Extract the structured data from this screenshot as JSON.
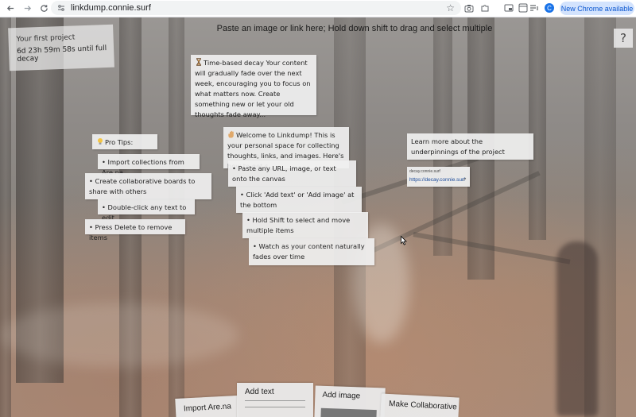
{
  "browser": {
    "url": "linkdump.connie.surf",
    "avatar_letter": "C",
    "update_label": "New Chrome available",
    "icons": [
      "back-icon",
      "forward-icon",
      "reload-icon",
      "tune-icon",
      "star-icon",
      "camera-icon",
      "extensions-icon",
      "cast-icon",
      "tab-search-icon",
      "media-icon",
      "menu-icon"
    ]
  },
  "canvas": {
    "instruction": "Paste an image or link here; Hold down shift to drag and select multiple",
    "help_label": "?"
  },
  "project": {
    "name": "Your first project",
    "timer": "6d 23h 59m 58s until full decay"
  },
  "notes": {
    "decay_text": "Time-based decay Your content will gradually fade over the next week, encouraging you to focus on what matters now. Create something new or let your old thoughts fade away...",
    "welcome_text": "Welcome to Linkdump! This is your personal space for collecting thoughts, links, and images. Here's how to get s",
    "pro_tips": "Pro Tips:",
    "import_arena": "• Import collections from Are.na",
    "collab_boards": "• Create collaborative boards to share with others",
    "double_click": "• Double-click any text to edit",
    "press_delete": "• Press Delete to remove items",
    "paste_url": "• Paste any URL, image, or text onto the canvas",
    "add_text_tip": "• Click 'Add text' or 'Add image' at the bottom",
    "shift_tip": "• Hold Shift to select and move multiple items",
    "fade_tip": "• Watch as your content naturally fades over time",
    "learn_more": "Learn more about the underpinnings of the project"
  },
  "link_card": {
    "domain": "decay.connie.surf",
    "url": "https://decay.connie.surf"
  },
  "toolbar": {
    "import_label": "Import Are.na",
    "add_text_label": "Add text",
    "add_image_label": "Add image",
    "collab_label": "Make Collaborative"
  },
  "colors": {
    "note_bg": "#f0f0f0",
    "link_color": "#1a4a9a",
    "chrome_accent": "#d3e3fd",
    "avatar": "#1a73e8"
  }
}
